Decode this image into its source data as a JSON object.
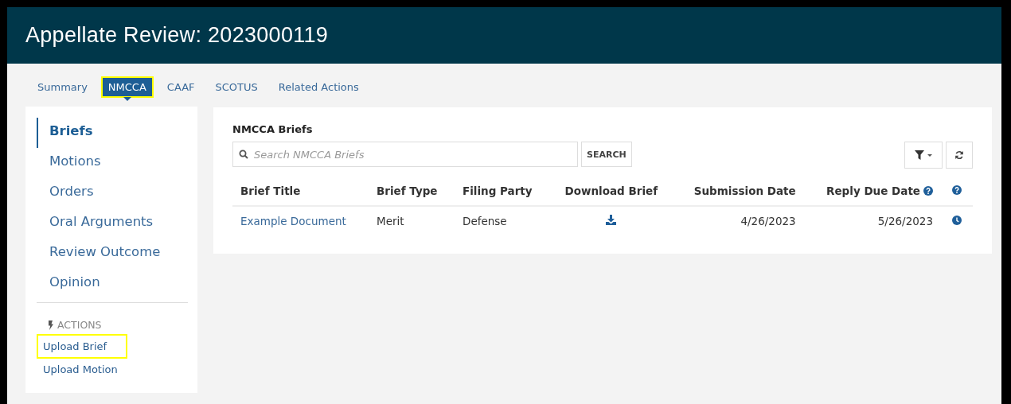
{
  "header": {
    "title": "Appellate Review: 2023000119"
  },
  "tabs": [
    {
      "label": "Summary",
      "selected": false,
      "highlighted": false
    },
    {
      "label": "NMCCA",
      "selected": true,
      "highlighted": true
    },
    {
      "label": "CAAF",
      "selected": false,
      "highlighted": false
    },
    {
      "label": "SCOTUS",
      "selected": false,
      "highlighted": false
    },
    {
      "label": "Related Actions",
      "selected": false,
      "highlighted": false
    }
  ],
  "sidebar": {
    "items": [
      {
        "label": "Briefs",
        "selected": true
      },
      {
        "label": "Motions",
        "selected": false
      },
      {
        "label": "Orders",
        "selected": false
      },
      {
        "label": "Oral Arguments",
        "selected": false
      },
      {
        "label": "Review Outcome",
        "selected": false
      },
      {
        "label": "Opinion",
        "selected": false
      }
    ],
    "actions_heading": "ACTIONS",
    "actions": [
      {
        "label": "Upload Brief",
        "highlighted": true
      },
      {
        "label": "Upload Motion",
        "highlighted": false
      }
    ]
  },
  "panel": {
    "title": "NMCCA Briefs",
    "search": {
      "placeholder": "Search NMCCA Briefs",
      "button": "SEARCH"
    },
    "table": {
      "columns": [
        {
          "label": "Brief Title",
          "help": false
        },
        {
          "label": "Brief Type",
          "help": false
        },
        {
          "label": "Filing Party",
          "help": false
        },
        {
          "label": "Download Brief",
          "help": false
        },
        {
          "label": "Submission Date",
          "help": false
        },
        {
          "label": "Reply Due Date",
          "help": true
        }
      ],
      "rows": [
        {
          "brief_title": "Example Document",
          "brief_type": "Merit",
          "filing_party": "Defense",
          "submission_date": "4/26/2023",
          "reply_due_date": "5/26/2023"
        }
      ]
    }
  }
}
